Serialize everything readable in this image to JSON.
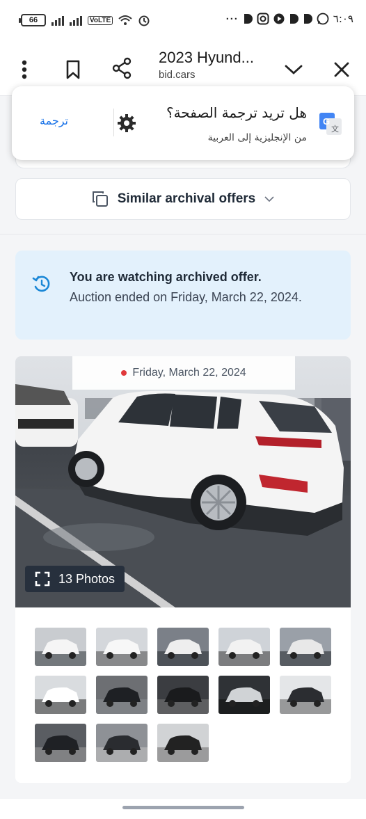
{
  "status_bar": {
    "battery": "66",
    "volte": "VoLTE",
    "time": "٦:٠٩",
    "icons": [
      "battery-icon",
      "signal-icon",
      "signal-icon",
      "volte-icon",
      "wifi-icon",
      "alarm-icon",
      "more-dots-icon",
      "app-icon",
      "instagram-icon",
      "play-icon",
      "app-icon",
      "app-icon",
      "whatsapp-icon"
    ]
  },
  "browser": {
    "title": "2023 Hyund...",
    "url": "bid.cars",
    "icons": [
      "menu-dots-icon",
      "bookmark-icon",
      "share-icon",
      "chevron-down-icon",
      "close-icon"
    ]
  },
  "translate_popup": {
    "question": "هل تريد ترجمة الصفحة؟",
    "subtitle": "من الإنجليزية إلى العربية",
    "translate_button": "ترجمة",
    "icons": [
      "google-translate-icon",
      "settings-gear-icon"
    ]
  },
  "similar": {
    "label": "Similar archival offers"
  },
  "archived_notice": {
    "title": "You are watching archived offer.",
    "body": "Auction ended on Friday, March 22, 2024."
  },
  "gallery": {
    "date": "Friday, March 22, 2024",
    "photos_label": "13 Photos",
    "thumb_count": 13
  }
}
